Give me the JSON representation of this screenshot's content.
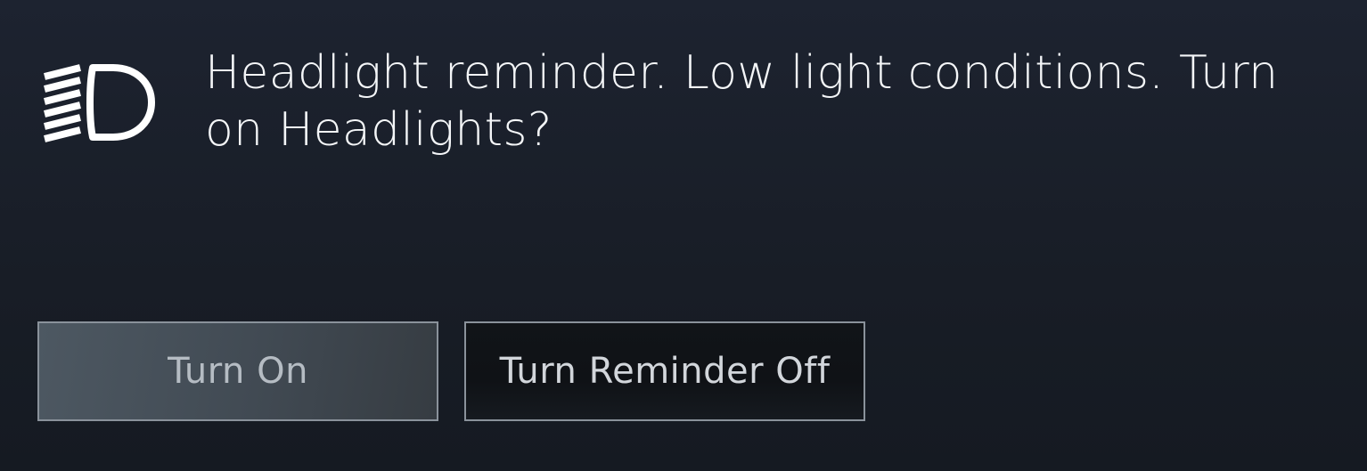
{
  "notification": {
    "icon": "headlight-icon",
    "message": "Headlight reminder. Low light conditions. Turn on Headlights?"
  },
  "buttons": {
    "turn_on_label": "Turn On",
    "turn_reminder_off_label": "Turn Reminder Off"
  },
  "colors": {
    "background": "#1b202a",
    "text": "#f4f6f8",
    "button_border": "#8a929b",
    "primary_button": "#4a545e",
    "secondary_button": "#111418"
  }
}
